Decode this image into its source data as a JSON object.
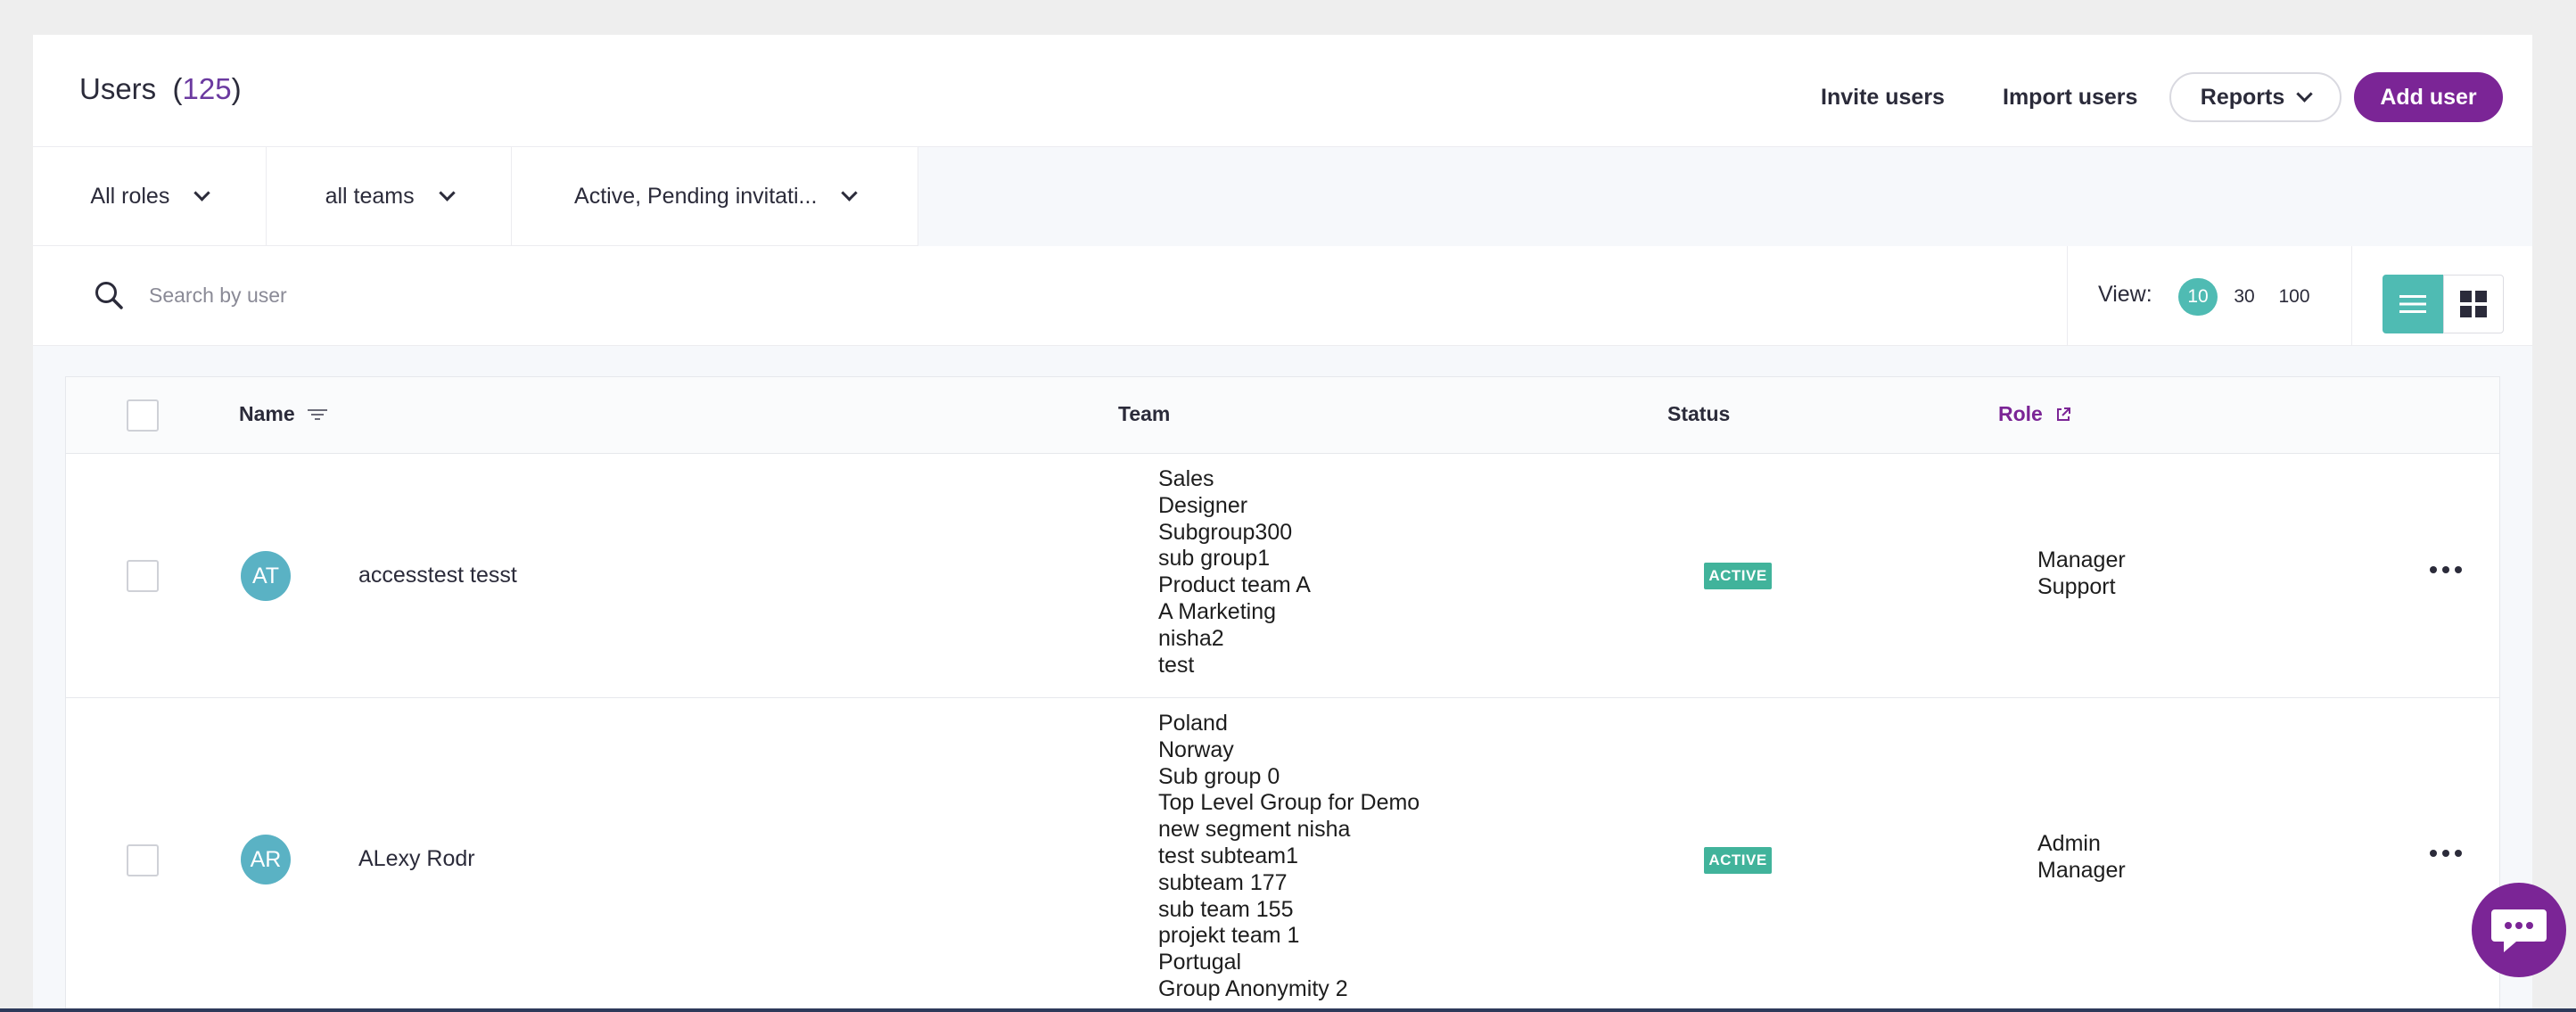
{
  "header": {
    "title": "Users",
    "count": "125",
    "invite_label": "Invite users",
    "import_label": "Import users",
    "reports_label": "Reports",
    "add_label": "Add user"
  },
  "filters": {
    "roles": "All roles",
    "teams": "all teams",
    "status": "Active, Pending invitati..."
  },
  "search": {
    "placeholder": "Search by user"
  },
  "view": {
    "label": "View:",
    "options": [
      "10",
      "30",
      "100"
    ],
    "selected": "10"
  },
  "table": {
    "columns": {
      "name": "Name",
      "team": "Team",
      "status": "Status",
      "role": "Role"
    },
    "rows": [
      {
        "initials": "AT",
        "name": "accesstest tesst",
        "teams": [
          "Sales",
          "Designer",
          "Subgroup300",
          "sub group1",
          "Product team A",
          "A Marketing",
          "nisha2",
          "test"
        ],
        "status": "ACTIVE",
        "roles": [
          "Manager",
          "Support"
        ]
      },
      {
        "initials": "AR",
        "name": "ALexy Rodr",
        "teams": [
          "Poland",
          "Norway",
          "Sub group 0",
          "Top Level Group for Demo",
          "new segment nisha",
          "test subteam1",
          "subteam 177",
          "sub team 155",
          "projekt team 1",
          "Portugal",
          "Group Anonymity 2"
        ],
        "status": "ACTIVE",
        "roles": [
          "Admin",
          "Manager"
        ]
      }
    ]
  },
  "colors": {
    "brand": "#7b2596",
    "accent": "#4fbbb3",
    "status_active": "#41b39b",
    "avatar": "#5ab2c4"
  }
}
